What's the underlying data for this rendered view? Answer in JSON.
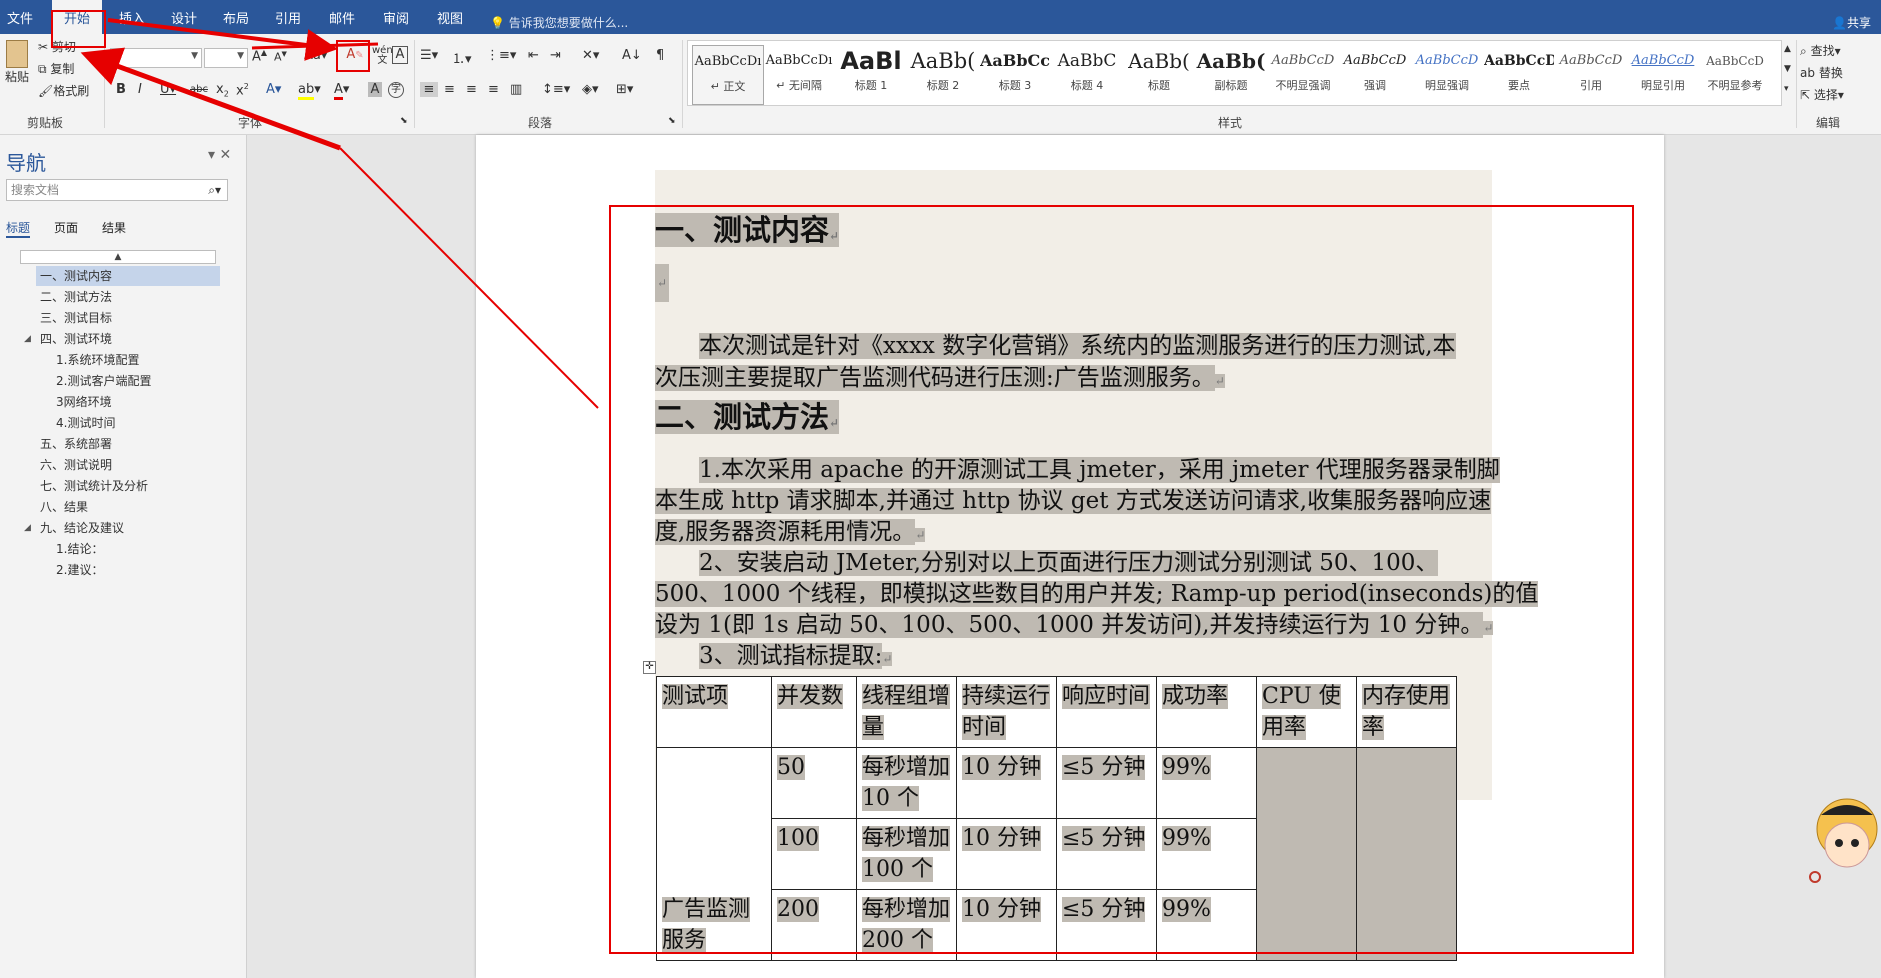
{
  "ribbon_tabs": [
    "文件",
    "开始",
    "插入",
    "设计",
    "布局",
    "引用",
    "邮件",
    "审阅",
    "视图"
  ],
  "tell_me": "告诉我您想要做什么...",
  "share": "共享",
  "clipboard": {
    "paste": "粘贴",
    "cut": "剪切",
    "copy": "复制",
    "format_painter": "格式刷",
    "label": "剪贴板"
  },
  "groups": {
    "font": "字体",
    "paragraph": "段落",
    "styles": "样式",
    "editing": "编辑"
  },
  "editing": {
    "find": "查找",
    "replace": "替换",
    "select": "选择"
  },
  "styles": [
    {
      "sample": "AaBbCcDı",
      "name": "↵ 正文"
    },
    {
      "sample": "AaBbCcDı",
      "name": "↵ 无间隔"
    },
    {
      "sample": "AaBl",
      "name": "标题 1"
    },
    {
      "sample": "AaBb(",
      "name": "标题 2"
    },
    {
      "sample": "AaBbCc",
      "name": "标题 3"
    },
    {
      "sample": "AaBbC",
      "name": "标题 4"
    },
    {
      "sample": "AaBb(",
      "name": "标题"
    },
    {
      "sample": "AaBb(",
      "name": "副标题"
    },
    {
      "sample": "AaBbCcD",
      "name": "不明显强调"
    },
    {
      "sample": "AaBbCcD",
      "name": "强调"
    },
    {
      "sample": "AaBbCcD",
      "name": "明显强调"
    },
    {
      "sample": "AaBbCcD",
      "name": "要点"
    },
    {
      "sample": "AaBbCcD",
      "name": "引用"
    },
    {
      "sample": "AaBbCcD",
      "name": "明显引用"
    },
    {
      "sample": "AaBbCcD",
      "name": "不明显参考"
    }
  ],
  "nav": {
    "title": "导航",
    "search_placeholder": "搜索文档",
    "tabs": [
      "标题",
      "页面",
      "结果"
    ],
    "items": [
      {
        "label": "一、测试内容",
        "level": 1,
        "selected": true
      },
      {
        "label": "二、测试方法",
        "level": 1
      },
      {
        "label": "三、测试目标",
        "level": 1
      },
      {
        "label": "四、测试环境",
        "level": 1,
        "expanded": true
      },
      {
        "label": "1.系统环境配置",
        "level": 2
      },
      {
        "label": "2.测试客户端配置",
        "level": 2
      },
      {
        "label": "3网络环境",
        "level": 2
      },
      {
        "label": "4.测试时间",
        "level": 2
      },
      {
        "label": "五、系统部署",
        "level": 1
      },
      {
        "label": "六、测试说明",
        "level": 1
      },
      {
        "label": "七、测试统计及分析",
        "level": 1
      },
      {
        "label": "八、结果",
        "level": 1
      },
      {
        "label": "九、结论及建议",
        "level": 1,
        "expanded": true
      },
      {
        "label": "1.结论：",
        "level": 2
      },
      {
        "label": "2.建议：",
        "level": 2
      }
    ]
  },
  "doc": {
    "h1": "一、测试内容",
    "p1a": "本次测试是针对《xxxx 数字化营销》系统内的监测服务进行的压力测试,本",
    "p1b": "次压测主要提取广告监测代码进行压测:广告监测服务。",
    "h2": "二、测试方法",
    "p2a": "1.本次采用 apache 的开源测试工具 jmeter，采用 jmeter 代理服务器录制脚",
    "p2b": "本生成 http 请求脚本,并通过 http 协议 get 方式发送访问请求,收集服务器响应速",
    "p2c": "度,服务器资源耗用情况。",
    "p3a": "2、安装启动 JMeter,分别对以上页面进行压力测试分别测试 50、100、",
    "p3b": "500、1000 个线程，即模拟这些数目的用户并发; Ramp-up period(inseconds)的值",
    "p3c": "设为 1(即 1s 启动 50、100、500、1000 并发访问),并发持续运行为 10 分钟。",
    "p4": "3、测试指标提取:",
    "para_mark": "↵"
  },
  "table": {
    "headers": [
      "测试项",
      "并发数",
      "线程组增量",
      "持续运行时间",
      "响应时间",
      "成功率",
      "CPU 使用率",
      "内存使用率"
    ],
    "item": "广告监测服务",
    "rows": [
      [
        "50",
        "每秒增加 10 个",
        "10 分钟",
        "≤5 分钟",
        "99%"
      ],
      [
        "100",
        "每秒增加 100 个",
        "10 分钟",
        "≤5 分钟",
        "99%"
      ],
      [
        "200",
        "每秒增加 200 个",
        "10 分钟",
        "≤5 分钟",
        "99%"
      ]
    ]
  },
  "colors": {
    "ribbon_blue": "#2b579a",
    "highlight": "#bfbab2",
    "annotation_red": "#e60000"
  }
}
